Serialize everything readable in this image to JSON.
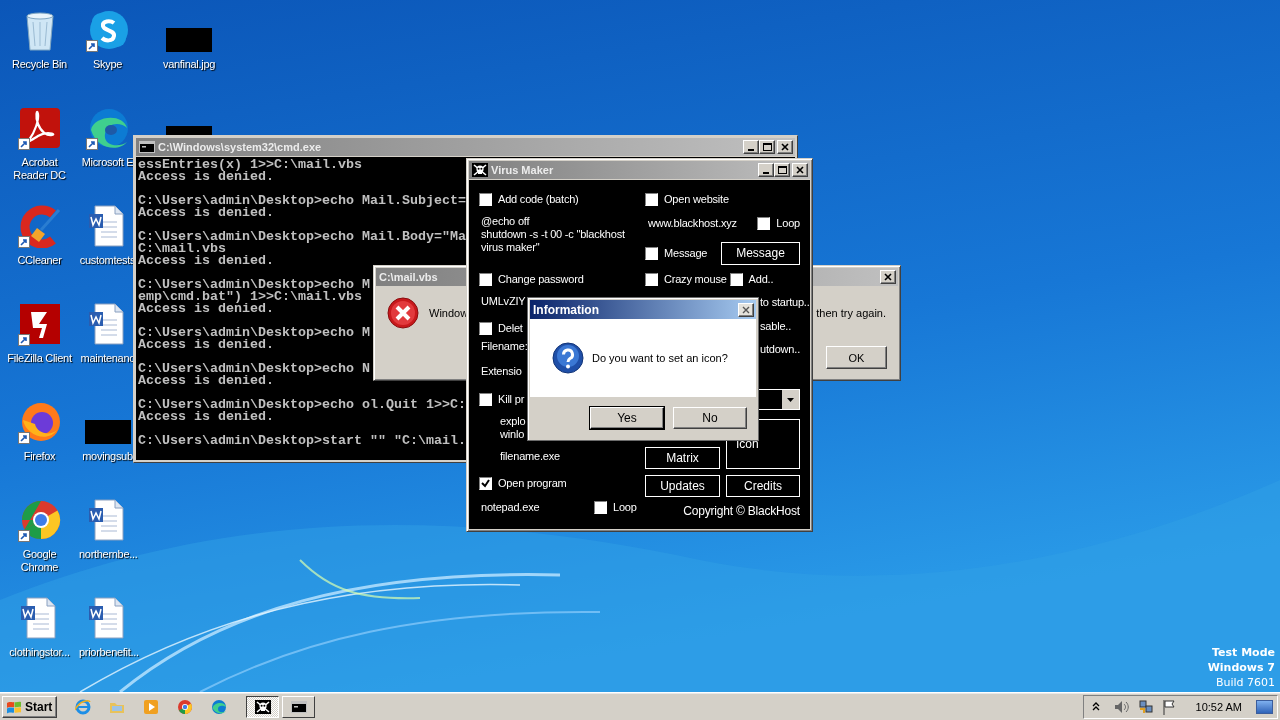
{
  "desktop": {
    "icon_columns": [
      [
        {
          "label": "Recycle Bin",
          "kind": "recycle",
          "shortcut": false
        },
        {
          "label": "Acrobat Reader DC",
          "kind": "acrobat",
          "shortcut": true
        },
        {
          "label": "CCleaner",
          "kind": "ccleaner",
          "shortcut": true
        },
        {
          "label": "FileZilla Client",
          "kind": "filezilla",
          "shortcut": true
        },
        {
          "label": "Firefox",
          "kind": "firefox",
          "shortcut": true
        },
        {
          "label": "Google Chrome",
          "kind": "chrome",
          "shortcut": true
        },
        {
          "label": "clothingstor...",
          "kind": "word",
          "shortcut": false
        }
      ],
      [
        {
          "label": "Skype",
          "kind": "skype",
          "shortcut": true
        },
        {
          "label": "Microsoft E",
          "kind": "edge",
          "shortcut": true
        },
        {
          "label": "customtests",
          "kind": "word",
          "shortcut": false
        },
        {
          "label": "maintenanc",
          "kind": "word",
          "shortcut": false
        },
        {
          "label": "movingsub",
          "kind": "redacted",
          "shortcut": false
        },
        {
          "label": "northernbe...",
          "kind": "word",
          "shortcut": false
        },
        {
          "label": "priorbenefit...",
          "kind": "word",
          "shortcut": false
        }
      ],
      [
        {
          "label": "vanfinal.jpg",
          "kind": "redacted",
          "shortcut": false
        },
        {
          "kind": "redacted"
        }
      ]
    ]
  },
  "cmd_window": {
    "title": "C:\\Windows\\system32\\cmd.exe",
    "active": false,
    "blocks": [
      [
        "essEntries(x) 1>>C:\\mail.vbs",
        "Access is denied."
      ],
      [
        "C:\\Users\\admin\\Desktop>echo Mail.Subject=",
        "Access is denied."
      ],
      [
        "C:\\Users\\admin\\Desktop>echo Mail.Body=\"Ma",
        "C:\\mail.vbs",
        "Access is denied."
      ],
      [
        "C:\\Users\\admin\\Desktop>echo M",
        "emp\\cmd.bat\") 1>>C:\\mail.vbs",
        "Access is denied."
      ],
      [
        "C:\\Users\\admin\\Desktop>echo M",
        "Access is denied."
      ],
      [
        "C:\\Users\\admin\\Desktop>echo N",
        "Access is denied."
      ],
      [
        "C:\\Users\\admin\\Desktop>echo ol.Quit 1>>C:",
        "Access is denied."
      ],
      [
        "C:\\Users\\admin\\Desktop>start \"\" \"C:\\mail."
      ]
    ]
  },
  "error_dialog": {
    "title": "C:\\mail.vbs",
    "active": false,
    "message_start": "Window",
    "message_end": "then try again.",
    "button": "OK"
  },
  "virus_maker": {
    "title": "Virus Maker",
    "active": false,
    "left": [
      {
        "kind": "checkbox",
        "label": "Add code (batch)",
        "checked": false
      },
      {
        "kind": "text",
        "lines": [
          "@echo off",
          "shutdown -s -t 00 -c \"blackhost",
          "virus maker\""
        ]
      },
      {
        "kind": "checkbox",
        "label": "Change password",
        "checked": false
      },
      {
        "kind": "text",
        "lines": [
          "UMLvZIY"
        ]
      },
      {
        "kind": "checkbox",
        "label": "Delet",
        "checked": false
      },
      {
        "kind": "text",
        "lines": [
          "Filename:"
        ]
      },
      {
        "kind": "text",
        "lines": [
          "Extensio"
        ]
      },
      {
        "kind": "checkbox",
        "label": "Kill pr",
        "checked": false
      },
      {
        "kind": "list",
        "lines": [
          "explo",
          "winlo"
        ]
      },
      {
        "kind": "list",
        "lines": [
          "filename.exe"
        ]
      },
      {
        "kind": "checkbox",
        "label": "Open program",
        "checked": true
      },
      {
        "kind": "text_loop",
        "text": "notepad.exe",
        "loop": {
          "label": "Loop",
          "checked": false
        }
      }
    ],
    "right": [
      {
        "kind": "checkbox",
        "label": "Open website",
        "checked": false
      },
      {
        "kind": "text_loop",
        "text": "www.blackhost.xyz",
        "loop": {
          "label": "Loop",
          "checked": false
        }
      },
      {
        "kind": "checkbox_button",
        "label": "Message",
        "checked": false,
        "button": "Message"
      },
      {
        "kind": "checkbox_pair",
        "label": "Crazy mouse",
        "checked": false,
        "second": {
          "label": "Add..",
          "checked": false
        }
      },
      {
        "kind": "tail",
        "text": "to startup.."
      },
      {
        "kind": "tail",
        "text": "sable.."
      },
      {
        "kind": "tail",
        "text": "utdown.."
      }
    ],
    "tiles": [
      {
        "kind": "tall",
        "label": "Icon"
      },
      {
        "kind": "button",
        "label": "Matrix"
      },
      {
        "kind": "button",
        "label": "Updates"
      },
      {
        "kind": "button",
        "label": "Credits"
      }
    ],
    "copyright": "Copyright © BlackHost"
  },
  "info_dialog": {
    "title": "Information",
    "active": true,
    "message": "Do you want to set an icon?",
    "buttons": [
      {
        "label": "Yes",
        "selected": true
      },
      {
        "label": "No",
        "selected": false
      }
    ]
  },
  "taskbar": {
    "start": "Start",
    "tasks": [
      {
        "kind": "skull",
        "selected": true
      },
      {
        "kind": "console",
        "selected": false
      }
    ],
    "clock": "10:52 AM"
  },
  "test_mode_notice": [
    "Test Mode",
    "Windows 7",
    "Build 7601"
  ]
}
